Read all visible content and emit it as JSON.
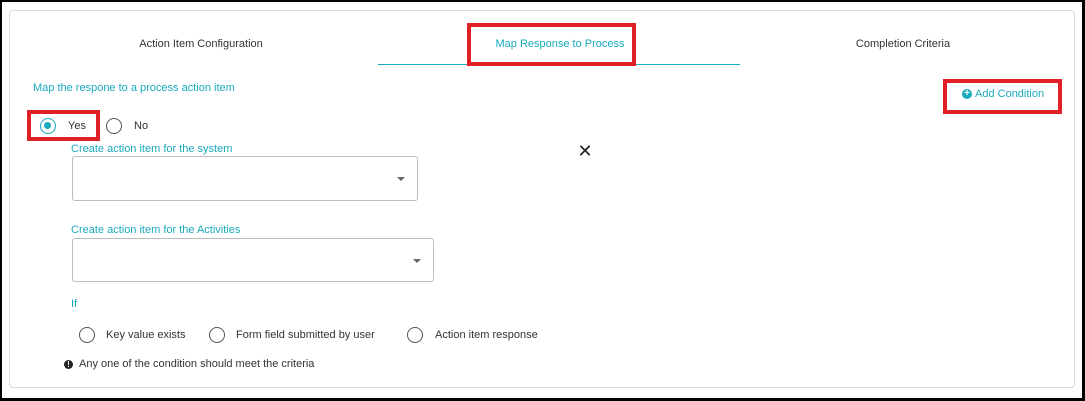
{
  "tabs": [
    {
      "label": "Action Item Configuration",
      "active": false
    },
    {
      "label": "Map Response to Process",
      "active": true
    },
    {
      "label": "Completion Criteria",
      "active": false
    }
  ],
  "section": {
    "title": "Map the respone to a process action item",
    "add_condition_label": "Add Condition"
  },
  "map_choice": {
    "selected": "Yes",
    "options": [
      "Yes",
      "No"
    ]
  },
  "system_select": {
    "label": "Create action item for the system",
    "value": ""
  },
  "activities_select": {
    "label": "Create action item for the Activities",
    "value": ""
  },
  "if_section": {
    "label": "If",
    "options": [
      "Key value exists",
      "Form field submitted by user",
      "Action item response"
    ],
    "note": "Any one of the condition should meet the criteria"
  },
  "icons": {
    "close": "close-icon",
    "add": "plus-circle-icon",
    "info": "info-icon",
    "dropdown": "chevron-down-icon"
  },
  "colors": {
    "accent": "#1aaabd",
    "highlight": "#e01f26"
  }
}
